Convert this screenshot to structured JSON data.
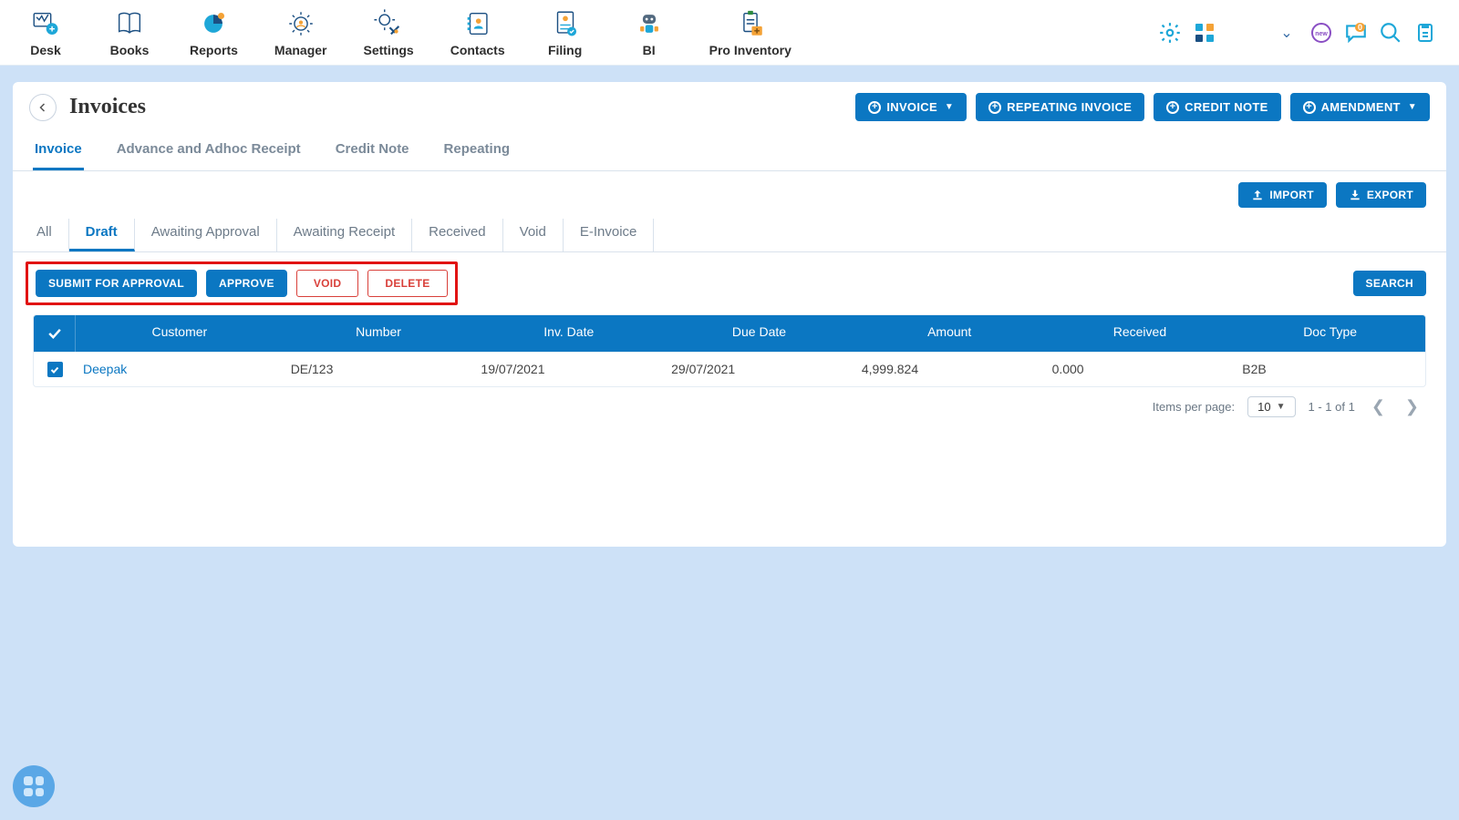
{
  "topnav": {
    "items": [
      {
        "label": "Desk"
      },
      {
        "label": "Books"
      },
      {
        "label": "Reports"
      },
      {
        "label": "Manager"
      },
      {
        "label": "Settings"
      },
      {
        "label": "Contacts"
      },
      {
        "label": "Filing"
      },
      {
        "label": "BI"
      },
      {
        "label": "Pro Inventory"
      }
    ]
  },
  "page": {
    "title": "Invoices",
    "actions": {
      "invoice": "INVOICE",
      "repeating": "REPEATING INVOICE",
      "credit_note": "CREDIT NOTE",
      "amendment": "AMENDMENT"
    }
  },
  "tabs1": [
    {
      "label": "Invoice",
      "active": true
    },
    {
      "label": "Advance and Adhoc Receipt"
    },
    {
      "label": "Credit Note"
    },
    {
      "label": "Repeating"
    }
  ],
  "io_buttons": {
    "import": "IMPORT",
    "export": "EXPORT"
  },
  "filter_tabs": [
    {
      "label": "All"
    },
    {
      "label": "Draft",
      "active": true
    },
    {
      "label": "Awaiting Approval"
    },
    {
      "label": "Awaiting Receipt"
    },
    {
      "label": "Received"
    },
    {
      "label": "Void"
    },
    {
      "label": "E-Invoice"
    }
  ],
  "bulk_actions": {
    "submit": "SUBMIT FOR APPROVAL",
    "approve": "APPROVE",
    "void": "VOID",
    "delete": "DELETE"
  },
  "search_label": "SEARCH",
  "table": {
    "headers": {
      "customer": "Customer",
      "number": "Number",
      "inv_date": "Inv. Date",
      "due_date": "Due Date",
      "amount": "Amount",
      "received": "Received",
      "doc_type": "Doc Type"
    },
    "rows": [
      {
        "customer": "Deepak",
        "number": "DE/123",
        "inv_date": "19/07/2021",
        "due_date": "29/07/2021",
        "amount": "4,999.824",
        "received": "0.000",
        "doc_type": "B2B"
      }
    ]
  },
  "pagination": {
    "items_per_page_label": "Items per page:",
    "page_size": "10",
    "range": "1 - 1 of 1"
  },
  "notification_count": "0"
}
